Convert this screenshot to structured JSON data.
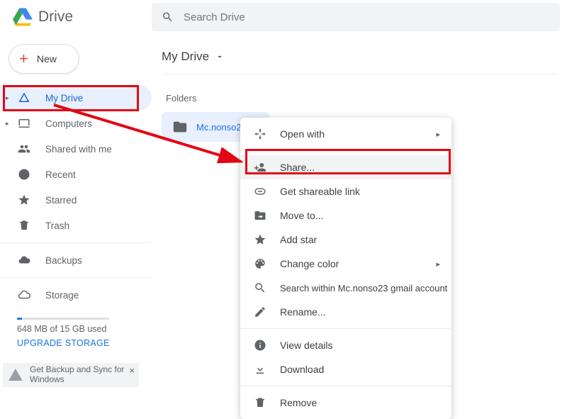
{
  "app": {
    "name": "Drive"
  },
  "search": {
    "placeholder": "Search Drive"
  },
  "new_button": {
    "label": "New"
  },
  "sidebar": {
    "items": [
      {
        "label": "My Drive",
        "icon": "drive-icon",
        "active": true,
        "has_caret": true
      },
      {
        "label": "Computers",
        "icon": "computers-icon",
        "has_caret": true
      },
      {
        "label": "Shared with me",
        "icon": "shared-icon"
      },
      {
        "label": "Recent",
        "icon": "recent-icon"
      },
      {
        "label": "Starred",
        "icon": "star-icon"
      },
      {
        "label": "Trash",
        "icon": "trash-icon"
      }
    ],
    "backups": {
      "label": "Backups"
    },
    "storage": {
      "label": "Storage",
      "used_text": "648 MB of 15 GB used",
      "upgrade_label": "UPGRADE STORAGE",
      "fill_percent": 5
    }
  },
  "breadcrumb": {
    "label": "My Drive"
  },
  "folders_section": {
    "label": "Folders"
  },
  "folder": {
    "name": "Mc.nonso23"
  },
  "context_menu": {
    "items": [
      {
        "label": "Open with",
        "icon": "open-with-icon",
        "submenu": true
      },
      {
        "label": "Share...",
        "icon": "person-add-icon",
        "highlight": true
      },
      {
        "label": "Get shareable link",
        "icon": "link-icon"
      },
      {
        "label": "Move to...",
        "icon": "move-icon"
      },
      {
        "label": "Add star",
        "icon": "star-icon"
      },
      {
        "label": "Change color",
        "icon": "palette-icon",
        "submenu": true
      },
      {
        "label": "Search within Mc.nonso23 gmail account",
        "icon": "search-icon"
      },
      {
        "label": "Rename...",
        "icon": "rename-icon"
      },
      {
        "label": "View details",
        "icon": "info-icon"
      },
      {
        "label": "Download",
        "icon": "download-icon"
      },
      {
        "label": "Remove",
        "icon": "trash-icon"
      }
    ]
  },
  "promo": {
    "text": "Get Backup and Sync for Windows"
  }
}
